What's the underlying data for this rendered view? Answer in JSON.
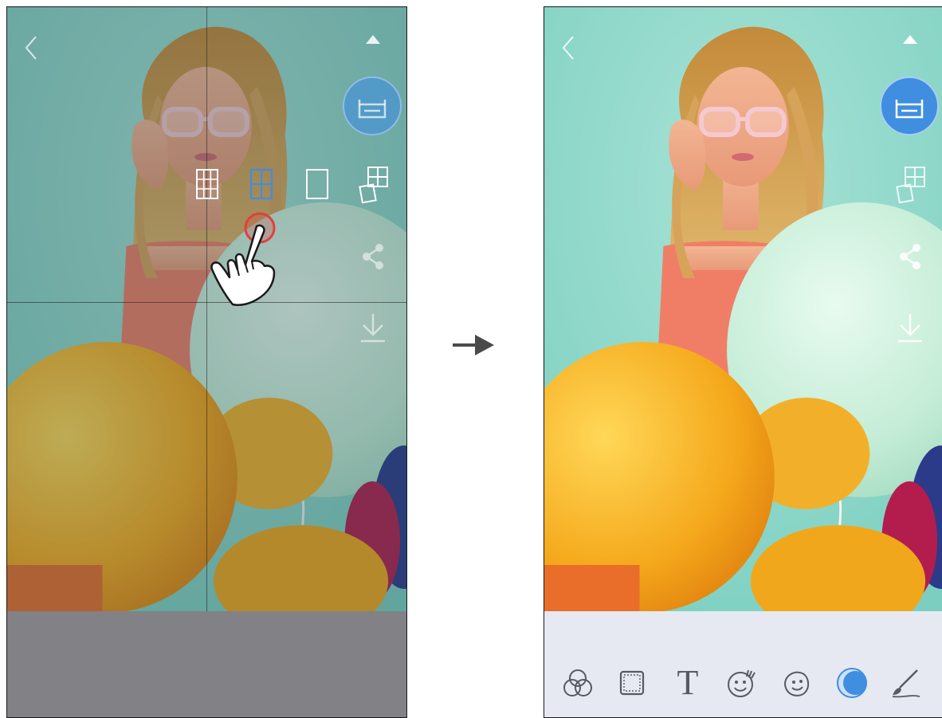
{
  "screens": [
    {
      "id": "before",
      "state": "layout menu open",
      "layout_options": [
        {
          "icon": "grid-3x3-layout-icon",
          "selected": false
        },
        {
          "icon": "grid-2x2-layout-icon",
          "selected": true
        },
        {
          "icon": "single-photo-layout-icon",
          "selected": false
        }
      ],
      "tap_indicator": "hand-tap-icon"
    },
    {
      "id": "after",
      "state": "editing toolbar",
      "toolbar": [
        {
          "icon": "filters-icon"
        },
        {
          "icon": "frame-icon"
        },
        {
          "icon": "text-icon",
          "label": "T"
        },
        {
          "icon": "sticker-icon"
        },
        {
          "icon": "face-sticker-icon"
        },
        {
          "icon": "color-blend-icon",
          "active": true
        },
        {
          "icon": "brush-icon"
        }
      ]
    }
  ],
  "side_actions": [
    "collapse-up-icon",
    "print-icon",
    "collage-icon",
    "share-icon",
    "download-icon"
  ],
  "colors": {
    "accent_blue": "#3f8ee0",
    "tap_ring_red": "#e0403a",
    "panel_gray": "#828286",
    "panel_light": "#e6e9f2",
    "icon_white": "#ffffff",
    "toolbar_icon": "#555a66"
  },
  "transition_arrow": "right-arrow-icon"
}
